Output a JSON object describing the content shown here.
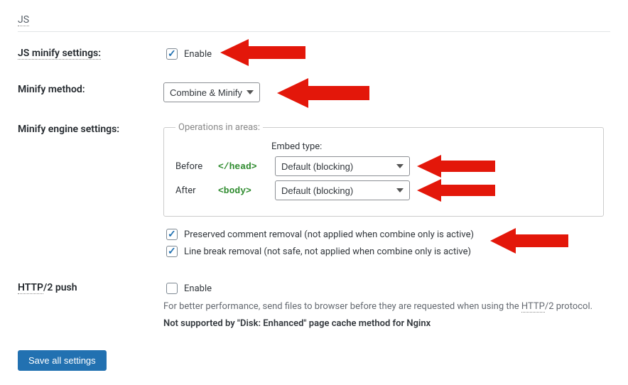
{
  "section": {
    "title": "JS"
  },
  "rows": {
    "minify_settings_label": "JS minify settings:",
    "minify_method_label": "Minify method:",
    "engine_settings_label": "Minify engine settings:",
    "http2_label": "HTTP/2 push"
  },
  "enable_label": "Enable",
  "minify_method": {
    "selected": "Combine & Minify"
  },
  "operations": {
    "legend": "Operations in areas:",
    "embed_header": "Embed type:",
    "before_label": "Before",
    "after_label": "After",
    "head_tag": "</head>",
    "body_tag": "<body>",
    "embed_before_value": "Default (blocking)",
    "embed_after_value": "Default (blocking)"
  },
  "checkboxes": {
    "preserved_comment": "Preserved comment removal (not applied when combine only is active)",
    "line_break": "Line break removal (not safe, not applied when combine only is active)"
  },
  "http2": {
    "enable_label": "Enable",
    "help_pre": "For better performance, send files to browser before they are requested when using the ",
    "help_http": "HTTP",
    "help_post": "/2 protocol.",
    "not_supported": "Not supported by \"Disk: Enhanced\" page cache method for Nginx"
  },
  "save_button": "Save all settings"
}
